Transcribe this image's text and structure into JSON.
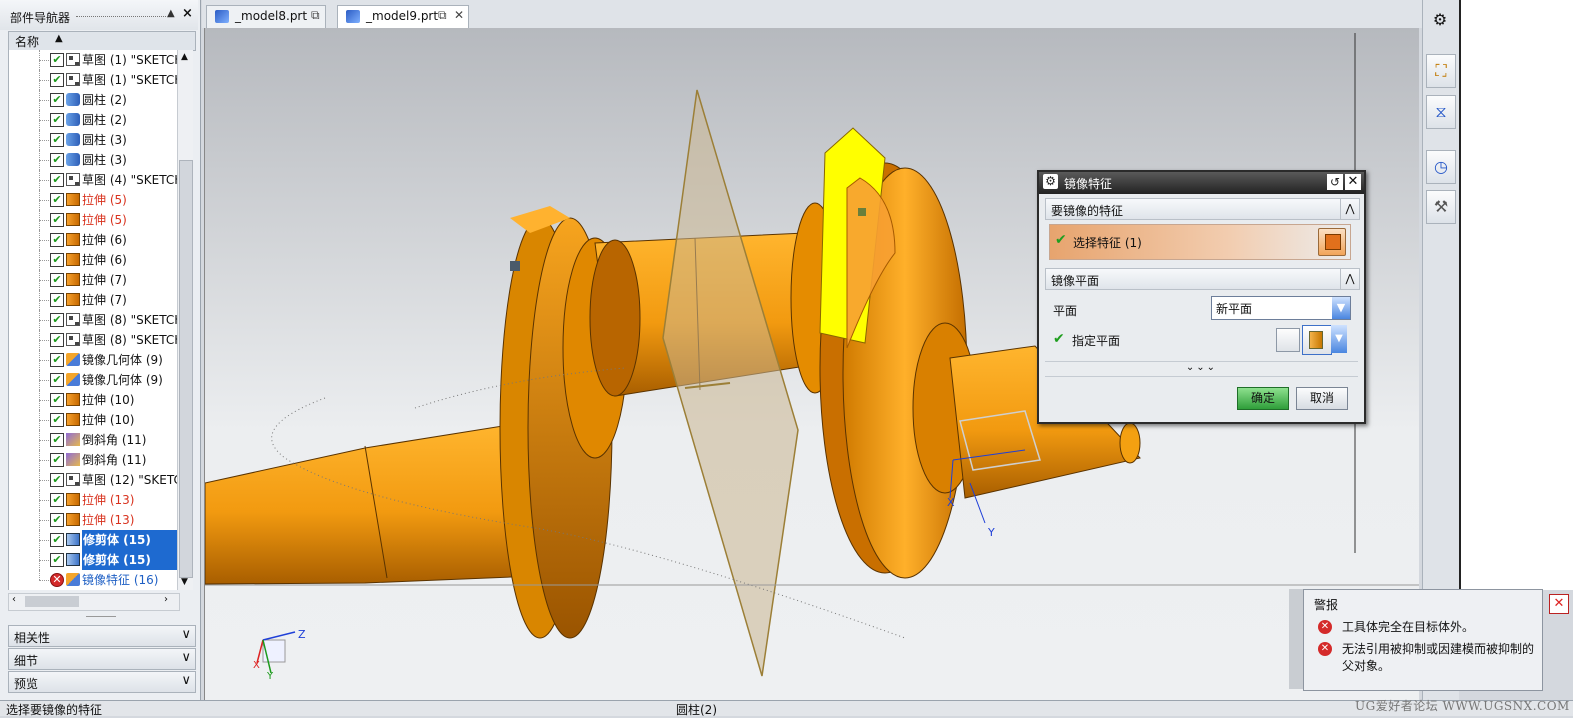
{
  "navigator": {
    "title": "部件导航器",
    "column_header": "名称",
    "rows": [
      {
        "label": "草图 (1) \"SKETCH",
        "icon": "sketch-icon",
        "color": "normal",
        "checked": true
      },
      {
        "label": "草图 (1) \"SKETCH",
        "icon": "sketch-icon",
        "color": "normal",
        "checked": true
      },
      {
        "label": "圆柱 (2)",
        "icon": "cylinder-icon",
        "color": "normal",
        "checked": true
      },
      {
        "label": "圆柱 (2)",
        "icon": "cylinder-icon",
        "color": "normal",
        "checked": true
      },
      {
        "label": "圆柱 (3)",
        "icon": "cylinder-icon",
        "color": "normal",
        "checked": true
      },
      {
        "label": "圆柱 (3)",
        "icon": "cylinder-icon",
        "color": "normal",
        "checked": true
      },
      {
        "label": "草图 (4) \"SKETCH",
        "icon": "sketch-icon",
        "color": "normal",
        "checked": true
      },
      {
        "label": "拉伸 (5)",
        "icon": "extrude-icon",
        "color": "red",
        "checked": true
      },
      {
        "label": "拉伸 (5)",
        "icon": "extrude-icon",
        "color": "red",
        "checked": true
      },
      {
        "label": "拉伸 (6)",
        "icon": "extrude-icon",
        "color": "normal",
        "checked": true
      },
      {
        "label": "拉伸 (6)",
        "icon": "extrude-icon",
        "color": "normal",
        "checked": true
      },
      {
        "label": "拉伸 (7)",
        "icon": "extrude-icon",
        "color": "normal",
        "checked": true
      },
      {
        "label": "拉伸 (7)",
        "icon": "extrude-icon",
        "color": "normal",
        "checked": true
      },
      {
        "label": "草图 (8) \"SKETCH",
        "icon": "sketch-icon",
        "color": "normal",
        "checked": true
      },
      {
        "label": "草图 (8) \"SKETCH",
        "icon": "sketch-icon",
        "color": "normal",
        "checked": true
      },
      {
        "label": "镜像几何体 (9)",
        "icon": "mirror-geometry-icon",
        "color": "normal",
        "checked": true
      },
      {
        "label": "镜像几何体 (9)",
        "icon": "mirror-geometry-icon",
        "color": "normal",
        "checked": true
      },
      {
        "label": "拉伸 (10)",
        "icon": "extrude-icon",
        "color": "normal",
        "checked": true
      },
      {
        "label": "拉伸 (10)",
        "icon": "extrude-icon",
        "color": "normal",
        "checked": true
      },
      {
        "label": "倒斜角 (11)",
        "icon": "chamfer-icon",
        "color": "normal",
        "checked": true
      },
      {
        "label": "倒斜角 (11)",
        "icon": "chamfer-icon",
        "color": "normal",
        "checked": true
      },
      {
        "label": "草图 (12) \"SKETC",
        "icon": "sketch-icon",
        "color": "normal",
        "checked": true
      },
      {
        "label": "拉伸 (13)",
        "icon": "extrude-icon",
        "color": "red",
        "checked": true
      },
      {
        "label": "拉伸 (13)",
        "icon": "extrude-icon",
        "color": "red",
        "checked": true
      },
      {
        "label": "修剪体 (15)",
        "icon": "trim-body-icon",
        "color": "selected",
        "checked": true
      },
      {
        "label": "修剪体 (15)",
        "icon": "trim-body-icon",
        "color": "selected",
        "checked": true
      },
      {
        "label": "镜像特征 (16)",
        "icon": "mirror-feature-icon",
        "color": "blue",
        "checked": false
      }
    ],
    "panels": [
      {
        "label": "相关性"
      },
      {
        "label": "细节"
      },
      {
        "label": "预览"
      }
    ]
  },
  "tabs": [
    {
      "label": "_model8.prt",
      "active": false
    },
    {
      "label": "_model9.prt",
      "active": true
    }
  ],
  "dialog": {
    "title": "镜像特征",
    "section_features": "要镜像的特征",
    "select_features": "选择特征 (1)",
    "section_plane": "镜像平面",
    "plane_label": "平面",
    "plane_value": "新平面",
    "specify_plane": "指定平面",
    "ok": "确定",
    "cancel": "取消"
  },
  "alert": {
    "title": "警报",
    "messages": [
      "工具体完全在目标体外。",
      "无法引用被抑制或因建模而被抑制的父对象。"
    ]
  },
  "status_bar": {
    "prompt": "选择要镜像的特征",
    "selection": "圆柱(2)",
    "watermark": "UG爱好者论坛 WWW.UGSNX.COM"
  },
  "triad": {
    "z": "Z",
    "x": "X",
    "y": "Y"
  },
  "csys": {
    "x": "X",
    "y": "Y"
  },
  "colors": {
    "part": "#f5a21c",
    "selection": "#1e6ad0",
    "accent_yellow": "#ffff00"
  }
}
